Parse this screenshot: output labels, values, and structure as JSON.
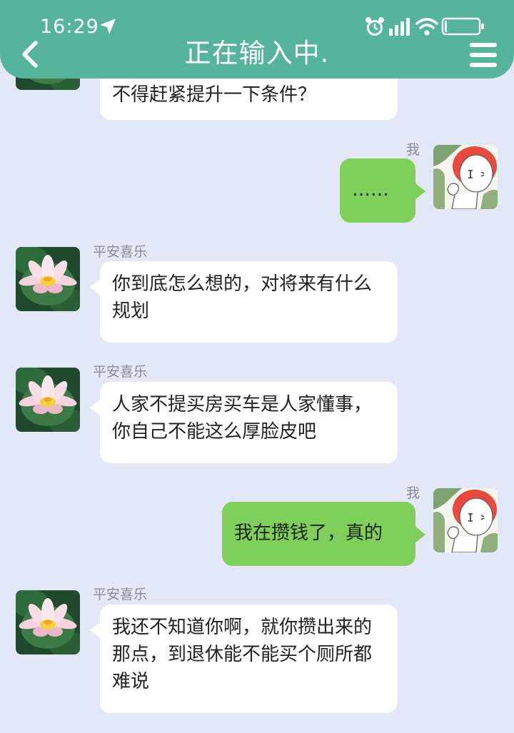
{
  "status_bar": {
    "time": "16:29",
    "icons": [
      "location-arrow-icon",
      "alarm-icon",
      "signal-icon",
      "wifi-icon",
      "battery-icon"
    ]
  },
  "header": {
    "title": "正在输入中.",
    "back_icon": "chevron-left-icon",
    "menu_icon": "hamburger-menu-icon"
  },
  "colors": {
    "header": "#56b39c",
    "background": "#e3e7f7",
    "bubble_incoming": "#ffffff",
    "bubble_outgoing": "#7fd05a"
  },
  "messages": [
    {
      "side": "left",
      "sender": "",
      "text": "不得赶紧提升一下条件？"
    },
    {
      "side": "right",
      "sender": "我",
      "text": "……"
    },
    {
      "side": "left",
      "sender": "平安喜乐",
      "text": "你到底怎么想的，对将来有什么规划"
    },
    {
      "side": "left",
      "sender": "平安喜乐",
      "text": "人家不提买房买车是人家懂事，你自己不能这么厚脸皮吧"
    },
    {
      "side": "right",
      "sender": "我",
      "text": "我在攒钱了，真的"
    },
    {
      "side": "left",
      "sender": "平安喜乐",
      "text": "我还不知道你啊，就你攒出来的那点，到退休能不能买个厕所都难说"
    }
  ]
}
